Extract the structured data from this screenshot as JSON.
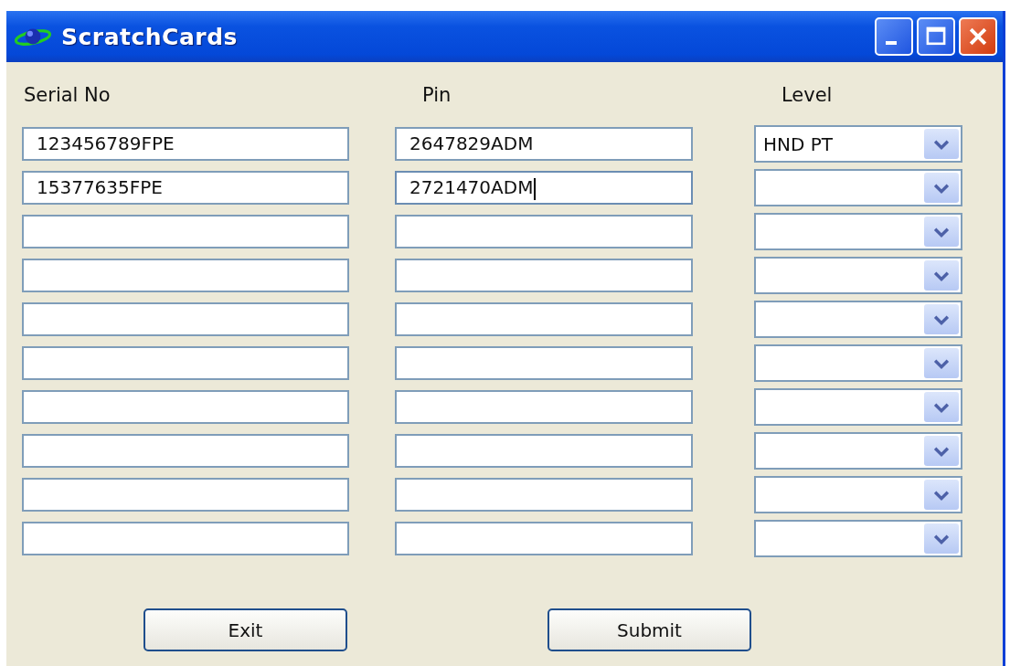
{
  "window": {
    "title": "ScratchCards"
  },
  "headers": {
    "serial": "Serial No",
    "pin": "Pin",
    "level": "Level"
  },
  "rows": [
    {
      "serial": "123456789FPE",
      "pin": "2647829ADM",
      "level": "HND PT",
      "focused": false
    },
    {
      "serial": "15377635FPE",
      "pin": "2721470ADM",
      "focused": true
    },
    {
      "focused": false
    },
    {
      "focused": false
    },
    {
      "focused": false
    },
    {
      "focused": false
    },
    {
      "focused": false
    },
    {
      "focused": false
    },
    {
      "focused": false
    },
    {
      "focused": false
    }
  ],
  "buttons": [
    "Exit",
    "Submit"
  ]
}
